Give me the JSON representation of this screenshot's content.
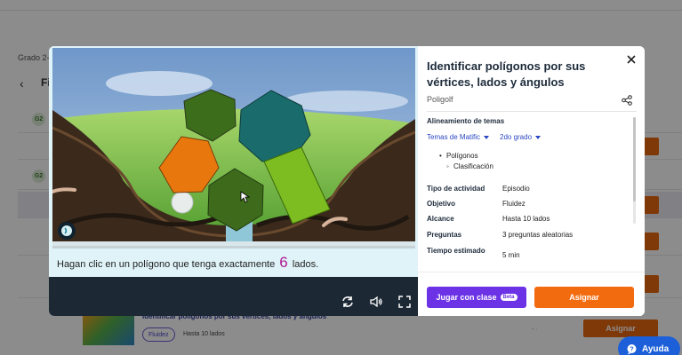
{
  "background": {
    "grade_label": "Grado 2-3",
    "page_title": "Fi",
    "row_badge": "G2",
    "list_item": {
      "title": "Identificar polígonos por sus vértices, lados y ángulos",
      "tag": "Fluidez",
      "range": "Hasta 10 lados",
      "assign_label": "Asignar",
      "dots": "-   ·"
    }
  },
  "game": {
    "instruction_prefix": "Hagan clic en un polígono que tenga exactamente",
    "target_sides": "6",
    "instruction_suffix": "lados."
  },
  "info": {
    "title": "Identificar polígonos por sus vértices, lados y ángulos",
    "subtitle": "Poligolf",
    "alignment_label": "Alineamiento de temas",
    "dropdown_topic": "Temas de Matific",
    "dropdown_grade": "2do grado",
    "topics": [
      "Polígonos"
    ],
    "subtopics": [
      "Clasificación"
    ],
    "meta": [
      {
        "key": "Tipo de actividad",
        "value": "Episodio"
      },
      {
        "key": "Objetivo",
        "value": "Fluidez"
      },
      {
        "key": "Alcance",
        "value": "Hasta 10 lados"
      },
      {
        "key": "Preguntas",
        "value": "3 preguntas aleatorias"
      },
      {
        "key": "Tiempo estimado",
        "value": "5 min"
      }
    ],
    "play_label": "Jugar con clase",
    "beta_label": "Beta",
    "assign_label": "Asignar"
  },
  "help": {
    "label": "Ayuda"
  },
  "colors": {
    "primary_purple": "#6c33e6",
    "primary_orange": "#f26b0f",
    "link_blue": "#2c47c4",
    "help_blue": "#1c5fd8",
    "dark_bar": "#1c2834"
  }
}
